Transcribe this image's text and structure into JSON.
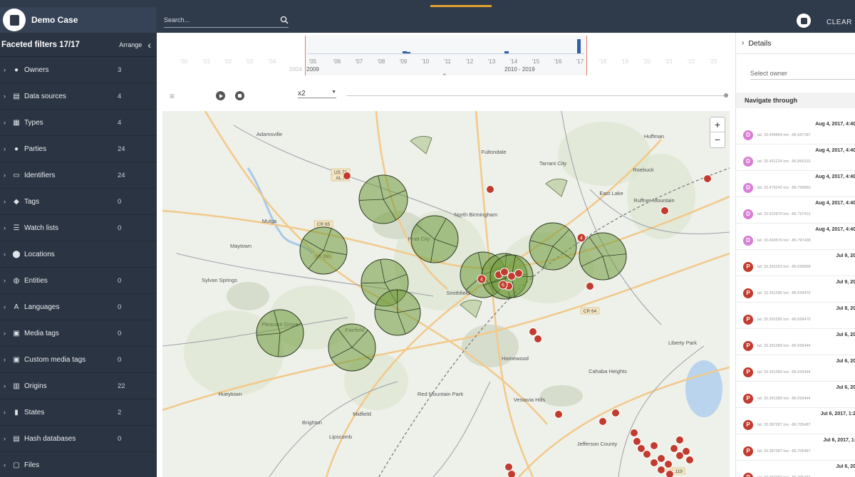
{
  "app": {
    "case_title": "Demo Case",
    "search_placeholder": "Search...",
    "clear_label": "CLEAR"
  },
  "sidebar": {
    "title": "Faceted filters 17/17",
    "arrange_label": "Arrange",
    "items": [
      {
        "label": "Owners",
        "count": "3",
        "icon": "person-circle-icon"
      },
      {
        "label": "Data sources",
        "count": "4",
        "icon": "documents-icon"
      },
      {
        "label": "Types",
        "count": "4",
        "icon": "grid-icon"
      },
      {
        "label": "Parties",
        "count": "24",
        "icon": "person-circle-icon"
      },
      {
        "label": "Identifiers",
        "count": "24",
        "icon": "id-card-icon"
      },
      {
        "label": "Tags",
        "count": "0",
        "icon": "tag-icon"
      },
      {
        "label": "Watch lists",
        "count": "0",
        "icon": "list-icon"
      },
      {
        "label": "Locations",
        "count": "",
        "icon": "pin-icon"
      },
      {
        "label": "Entities",
        "count": "0",
        "icon": "globe-icon"
      },
      {
        "label": "Languages",
        "count": "0",
        "icon": "translate-icon"
      },
      {
        "label": "Media tags",
        "count": "0",
        "icon": "image-icon"
      },
      {
        "label": "Custom media tags",
        "count": "0",
        "icon": "image-icon"
      },
      {
        "label": "Origins",
        "count": "22",
        "icon": "server-icon"
      },
      {
        "label": "States",
        "count": "2",
        "icon": "trash-icon"
      },
      {
        "label": "Hash databases",
        "count": "0",
        "icon": "database-icon"
      },
      {
        "label": "Files",
        "count": "",
        "icon": "files-icon"
      }
    ]
  },
  "timeline": {
    "ticks": [
      "'05",
      "'06",
      "'07",
      "'08",
      "'09",
      "'10",
      "'11",
      "'12",
      "'13",
      "'14",
      "'15",
      "'16",
      "'17"
    ],
    "faint_left": [
      "'00",
      "'01",
      "'02",
      "'03",
      "'04"
    ],
    "faint_right": [
      "'18",
      "'19",
      "'20",
      "'21",
      "'22",
      "'23"
    ],
    "range_start_top": "2004",
    "range_start_bottom": "2009",
    "range_label": "2010 - 2019",
    "bar_colors": {
      "bars": "#2e5fa8",
      "range_edges": "#e07c6c"
    }
  },
  "player": {
    "speed": "x2"
  },
  "map": {
    "place_labels": [
      "Adamsville",
      "Fultondale",
      "Huffman",
      "Tarrant City",
      "Roebuck",
      "East Lake",
      "Ruffner Mountain",
      "Maytown",
      "Mulga",
      "North Birmingham",
      "Pratt City",
      "Sylvan Springs",
      "Smithfield",
      "Pleasant Grove",
      "Fairfield",
      "Homewood",
      "Liberty Park",
      "Cahaba Heights",
      "Hueytown",
      "Midfield",
      "Vestavia Hills",
      "Red Mountain Park",
      "Lipscomb",
      "Brighton",
      "Jefferson County"
    ],
    "road_shields": [
      "US 78",
      "AL 5",
      "CR 65",
      "SR 269",
      "CR 64",
      "AL 119"
    ],
    "cluster_counts": [
      "4",
      "6",
      "4"
    ],
    "colors": {
      "circle_fill": "#6f9a3a",
      "pin": "#c23b2f",
      "road": "#f2c98a"
    }
  },
  "zoom": {
    "in": "+",
    "out": "−"
  },
  "details": {
    "title": "Details",
    "owner_placeholder": "Select owner",
    "navigate_label": "Navigate through",
    "items": [
      {
        "avatar": "D",
        "color": "#d77fd4",
        "time": "Aug 4, 2017, 4:40",
        "coords": "lat: 33.404854 lon: -86.947187"
      },
      {
        "avatar": "D",
        "color": "#d77fd4",
        "time": "Aug 4, 2017, 4:40",
        "coords": "lat: 33.451224 lon: -86.866310"
      },
      {
        "avatar": "D",
        "color": "#d77fd4",
        "time": "Aug 4, 2017, 4:40",
        "coords": "lat: 33.479242 lon: -86.799860"
      },
      {
        "avatar": "D",
        "color": "#d77fd4",
        "time": "Aug 4, 2017, 4:40",
        "coords": "lat: 33.522870 lon: -86.797412"
      },
      {
        "avatar": "D",
        "color": "#d77fd4",
        "time": "Aug 4, 2017, 4:40",
        "coords": "lat: 33.493570 lon: -86.797438"
      },
      {
        "avatar": "P",
        "color": "#c23b2f",
        "time": "Jul 9, 20",
        "coords": "lat: 33.391063 lon: -86.699699"
      },
      {
        "avatar": "P",
        "color": "#c23b2f",
        "time": "Jul 9, 20",
        "coords": "lat: 33.391285 lon: -86.699470"
      },
      {
        "avatar": "P",
        "color": "#c23b2f",
        "time": "Jul 8, 20",
        "coords": "lat: 33.391285 lon: -86.699470"
      },
      {
        "avatar": "P",
        "color": "#c23b2f",
        "time": "Jul 6, 20",
        "coords": "lat: 33.391389 lon: -86.699444"
      },
      {
        "avatar": "P",
        "color": "#c23b2f",
        "time": "Jul 6, 20",
        "coords": "lat: 33.391389 lon: -86.699444"
      },
      {
        "avatar": "P",
        "color": "#c23b2f",
        "time": "Jul 6, 20",
        "coords": "lat: 33.391389 lon: -86.699444"
      },
      {
        "avatar": "P",
        "color": "#c23b2f",
        "time": "Jul 6, 2017, 1:2",
        "coords": "lat: 33.387287 lon: -86.705487"
      },
      {
        "avatar": "P",
        "color": "#c23b2f",
        "time": "Jul 6, 2017, 1:",
        "coords": "lat: 33.387387 lon: -86.705487"
      },
      {
        "avatar": "P",
        "color": "#c23b2f",
        "time": "Jul 6, 20",
        "coords": "lat: 33.387387 lon: -86.705487"
      }
    ]
  }
}
